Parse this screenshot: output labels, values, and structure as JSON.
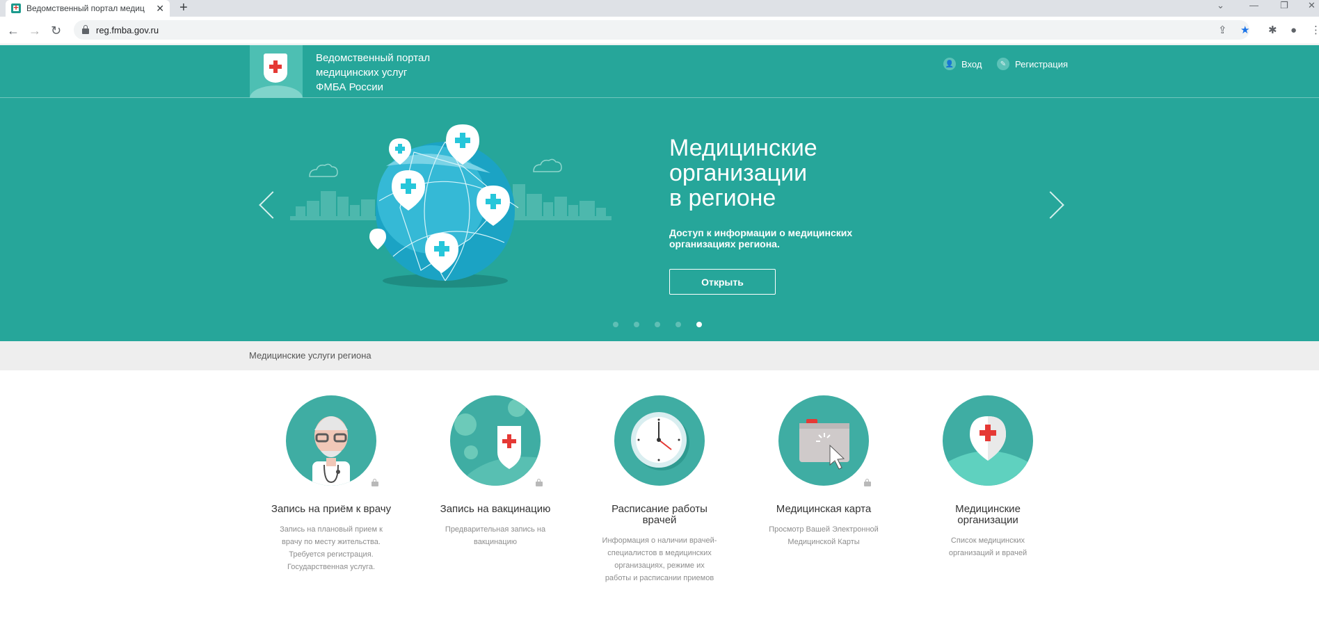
{
  "browser": {
    "tab_title": "Ведомственный портал медиц",
    "url": "reg.fmba.gov.ru"
  },
  "header": {
    "portal_name": [
      "Ведомственный портал",
      "медицинских услуг",
      "ФМБА России"
    ],
    "login": "Вход",
    "register": "Регистрация"
  },
  "hero": {
    "title": [
      "Медицинские",
      "организации",
      "в регионе"
    ],
    "description": "Доступ к информации о медицинских организациях региона.",
    "button": "Открыть",
    "slides_count": 5,
    "active_slide": 5
  },
  "services": {
    "section_title": "Медицинские услуги региона",
    "items": [
      {
        "title": "Запись на приём к врачу",
        "desc": "Запись на плановый прием к врачу по месту жительства. Требуется регистрация. Государственная услуга.",
        "locked": true,
        "icon": "doctor-icon"
      },
      {
        "title": "Запись на вакцинацию",
        "desc": "Предварительная запись на вакцинацию",
        "locked": true,
        "icon": "vaccination-icon"
      },
      {
        "title": "Расписание работы врачей",
        "desc": "Информация о наличии врачей-специалистов в медицинских организациях, режиме их работы и расписании приемов",
        "locked": false,
        "icon": "clock-icon"
      },
      {
        "title": "Медицинская карта",
        "desc": "Просмотр Вашей Электронной Медицинской Карты",
        "locked": true,
        "icon": "medical-card-icon"
      },
      {
        "title": "Медицинские организации",
        "desc": "Список медицинских организаций и врачей",
        "locked": false,
        "icon": "map-pin-icon"
      }
    ]
  },
  "colors": {
    "primary": "#26a69a",
    "circle": "#3fada3",
    "accent_red": "#e53935"
  }
}
